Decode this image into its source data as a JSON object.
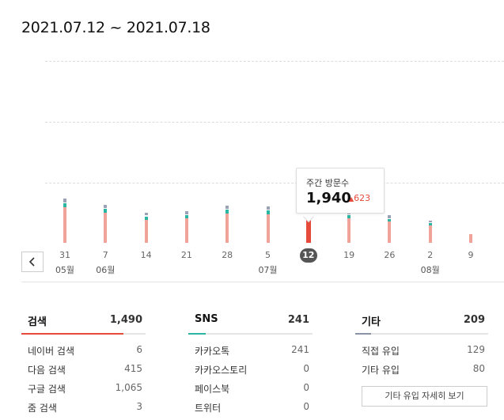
{
  "header": {
    "range": "2021.07.12 ~ 2021.07.18"
  },
  "chart_data": {
    "type": "bar",
    "categories": [
      "31",
      "7",
      "14",
      "21",
      "28",
      "5",
      "12",
      "19",
      "26",
      "2",
      "9"
    ],
    "months": [
      {
        "index": 0,
        "label": "05월"
      },
      {
        "index": 1,
        "label": "06월"
      },
      {
        "index": 5,
        "label": "07월"
      },
      {
        "index": 9,
        "label": "08월"
      }
    ],
    "series": [
      {
        "name": "검색",
        "color": "#f1a39a",
        "values": [
          1750,
          1500,
          1150,
          1200,
          1450,
          1400,
          1490,
          1200,
          1050,
          850,
          450
        ]
      },
      {
        "name": "SNS",
        "color": "#2bb6a3",
        "values": [
          250,
          230,
          200,
          210,
          220,
          230,
          241,
          200,
          180,
          150,
          0
        ]
      },
      {
        "name": "기타",
        "color": "#9aa3b5",
        "values": [
          220,
          200,
          180,
          180,
          200,
          200,
          209,
          180,
          160,
          130,
          0
        ]
      }
    ],
    "selected_index": 6,
    "selected_color": "#e64a3b",
    "ylim": [
      0,
      9000
    ],
    "gridlines": 3
  },
  "tooltip": {
    "title": "주간 방문수",
    "value": "1,940",
    "delta": "623"
  },
  "stats": [
    {
      "label": "검색",
      "total": "1,490",
      "color": "#e64a3b",
      "fill": 0.82,
      "rows": [
        {
          "label": "네이버 검색",
          "value": "6"
        },
        {
          "label": "다음 검색",
          "value": "415"
        },
        {
          "label": "구글 검색",
          "value": "1,065"
        },
        {
          "label": "줌 검색",
          "value": "3"
        }
      ]
    },
    {
      "label": "SNS",
      "total": "241",
      "color": "#2bb6a3",
      "fill": 0.14,
      "rows": [
        {
          "label": "카카오톡",
          "value": "241"
        },
        {
          "label": "카카오스토리",
          "value": "0"
        },
        {
          "label": "페이스북",
          "value": "0"
        },
        {
          "label": "트위터",
          "value": "0"
        }
      ]
    },
    {
      "label": "기타",
      "total": "209",
      "color": "#8a93a8",
      "fill": 0.12,
      "rows": [
        {
          "label": "직접 유입",
          "value": "129"
        },
        {
          "label": "기타 유입",
          "value": "80"
        }
      ]
    }
  ],
  "detail_button": "기타 유입 자세히 보기"
}
